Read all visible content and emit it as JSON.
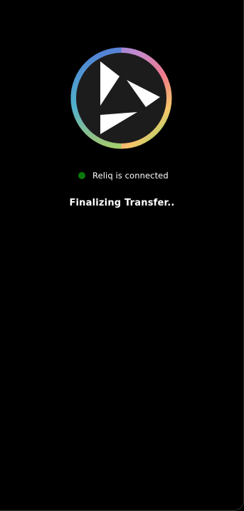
{
  "app": {
    "logo_icon": "reliq-logo-icon"
  },
  "status": {
    "indicator_color": "#0a7a0a",
    "text": "Reliq is connected"
  },
  "progress": {
    "message": "Finalizing Transfer.."
  },
  "colors": {
    "background": "#000000",
    "text": "#ffffff",
    "logo_inner": "#1c1c1c",
    "logo_ring": [
      "#4a7fd8",
      "#c38ad0",
      "#f07a8a",
      "#f7c56a",
      "#9ad66a",
      "#3fb8c8"
    ]
  }
}
